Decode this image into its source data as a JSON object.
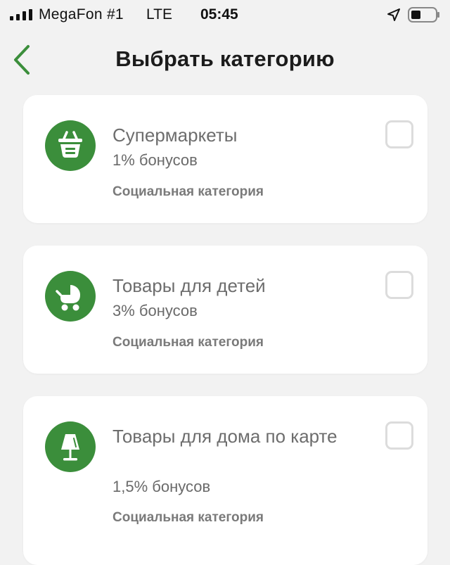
{
  "status_bar": {
    "carrier": "MegaFon #1",
    "network": "LTE",
    "time": "05:45"
  },
  "header": {
    "title": "Выбрать категорию"
  },
  "categories": [
    {
      "name": "Супермаркеты",
      "bonus": "1% бонусов",
      "type": "Социальная категория",
      "icon": "basket-icon",
      "checked": false
    },
    {
      "name": "Товары для детей",
      "bonus": "3% бонусов",
      "type": "Социальная категория",
      "icon": "stroller-icon",
      "checked": false
    },
    {
      "name": "Товары для дома по карте",
      "bonus": "1,5% бонусов",
      "type": "Социальная категория",
      "icon": "lamp-icon",
      "checked": false
    }
  ],
  "colors": {
    "accent_green": "#3b8e3b",
    "background": "#f2f2f2",
    "card": "#ffffff"
  }
}
